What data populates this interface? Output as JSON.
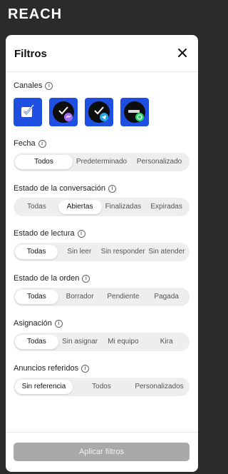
{
  "app": {
    "logo_text": "REACH"
  },
  "panel": {
    "title": "Filtros"
  },
  "channels": {
    "label": "Canales",
    "items": [
      {
        "name": "generic-chat"
      },
      {
        "name": "messenger"
      },
      {
        "name": "telegram"
      },
      {
        "name": "whatsapp"
      }
    ]
  },
  "filters": [
    {
      "label": "Fecha",
      "options": [
        "Todos",
        "Predeterminado",
        "Personalizado"
      ],
      "selected": 0
    },
    {
      "label": "Estado de la conversación",
      "options": [
        "Todas",
        "Abiertas",
        "Finalizadas",
        "Expiradas"
      ],
      "selected": 1
    },
    {
      "label": "Estado de lectura",
      "options": [
        "Todas",
        "Sin leer",
        "Sin responder",
        "Sin atender"
      ],
      "selected": 0
    },
    {
      "label": "Estado de la orden",
      "options": [
        "Todas",
        "Borrador",
        "Pendiente",
        "Pagada"
      ],
      "selected": 0
    },
    {
      "label": "Asignación",
      "options": [
        "Todas",
        "Sin asignar",
        "Mi equipo",
        "Kira"
      ],
      "selected": 0
    },
    {
      "label": "Anuncios referidos",
      "options": [
        "Sin referencia",
        "Todos",
        "Personalizados"
      ],
      "selected": 0
    }
  ],
  "footer": {
    "apply_label": "Aplicar filtros"
  },
  "colors": {
    "channel_bg": "#1f4fe0",
    "apply_bg": "#a9a9a9",
    "page_bg": "#2b2b2b"
  }
}
